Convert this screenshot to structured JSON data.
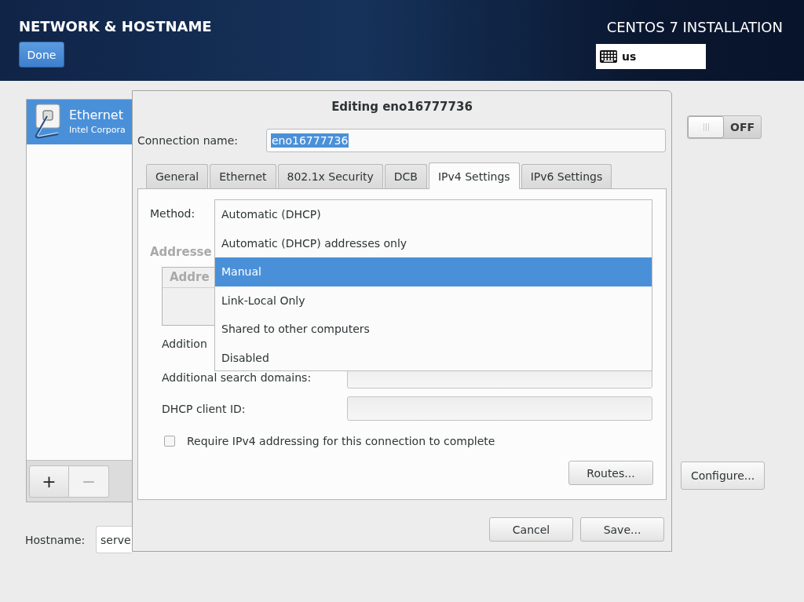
{
  "header": {
    "title": "NETWORK & HOSTNAME",
    "done_button": "Done",
    "product": "CENTOS 7 INSTALLATION",
    "keyboard_layout": "us"
  },
  "devices": [
    {
      "name": "Ethernet",
      "detail": "Intel Corpora",
      "selected": true
    }
  ],
  "device_toolbar": [
    {
      "kind": "add",
      "label": "+",
      "disabled": false
    },
    {
      "kind": "remove",
      "label": "−",
      "disabled": true
    }
  ],
  "device_switch": {
    "label": "OFF",
    "on": false
  },
  "configure_button": "Configure...",
  "hostname": {
    "label": "Hostname:",
    "value": "serve"
  },
  "dialog": {
    "title": "Editing eno16777736",
    "connection_name": {
      "label": "Connection name:",
      "value": "eno16777736",
      "text_selected": true
    },
    "tabs": [
      {
        "label": "General",
        "selected": false
      },
      {
        "label": "Ethernet",
        "selected": false
      },
      {
        "label": "802.1x Security",
        "selected": false
      },
      {
        "label": "DCB",
        "selected": false
      },
      {
        "label": "IPv4 Settings",
        "selected": true
      },
      {
        "label": "IPv6 Settings",
        "selected": false
      }
    ],
    "ipv4": {
      "method_label": "Method:",
      "method_menu": [
        {
          "label": "Automatic (DHCP)",
          "selected": false
        },
        {
          "label": "Automatic (DHCP) addresses only",
          "selected": false
        },
        {
          "label": "Manual",
          "selected": true
        },
        {
          "label": "Link-Local Only",
          "selected": false
        },
        {
          "label": "Shared to other computers",
          "selected": false
        },
        {
          "label": "Disabled",
          "selected": false
        }
      ],
      "addresses_heading": "Addresse",
      "addresses_column_1": "Addre",
      "additional_label": "Addition",
      "search_domains_label": "Additional search domains:",
      "dhcp_client_id_label": "DHCP client ID:",
      "require_checkbox": {
        "label": "Require IPv4 addressing for this connection to complete",
        "checked": false
      },
      "routes_button": "Routes..."
    },
    "buttons": [
      "Cancel",
      "Save..."
    ]
  }
}
